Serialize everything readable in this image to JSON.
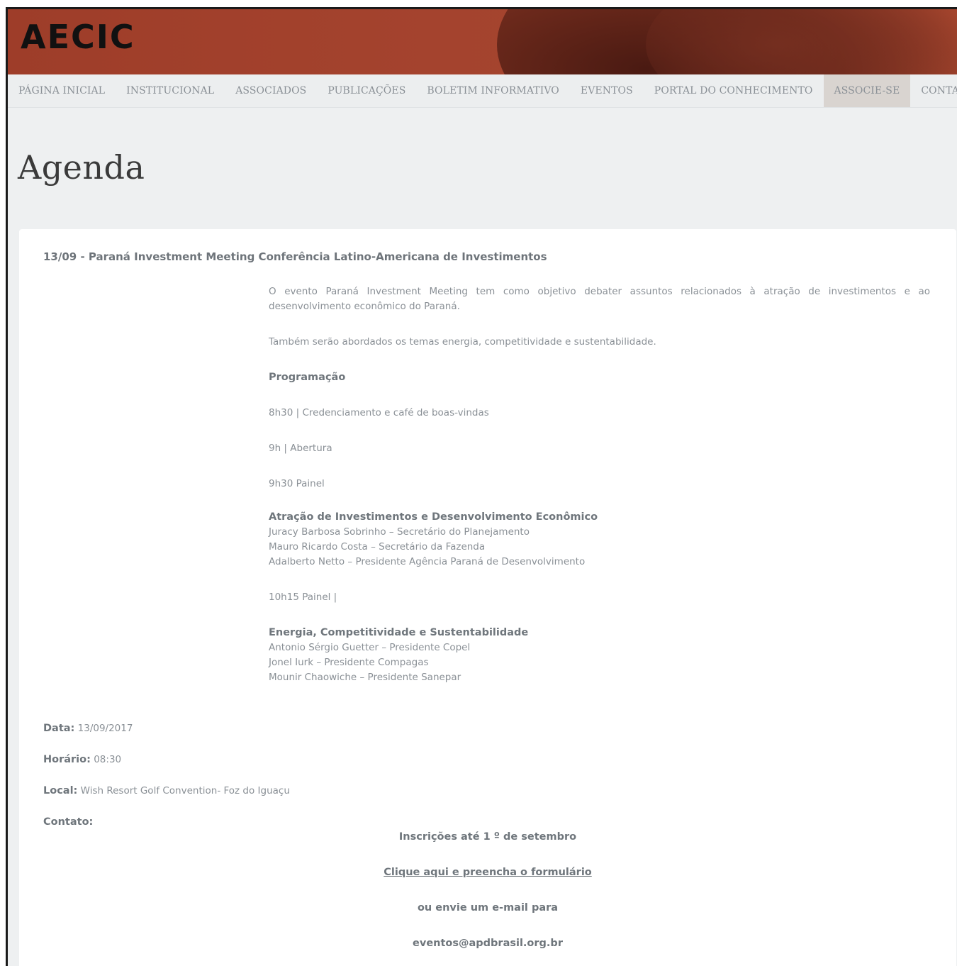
{
  "header": {
    "logo_text": "AECIC"
  },
  "nav": {
    "items": [
      {
        "label": "PÁGINA INICIAL"
      },
      {
        "label": "INSTITUCIONAL"
      },
      {
        "label": "ASSOCIADOS"
      },
      {
        "label": "PUBLICAÇÕES"
      },
      {
        "label": "BOLETIM INFORMATIVO"
      },
      {
        "label": "EVENTOS"
      },
      {
        "label": "PORTAL DO CONHECIMENTO"
      },
      {
        "label": "ASSOCIE-SE"
      },
      {
        "label": "CONTATO"
      }
    ],
    "active": "ASSOCIE-SE"
  },
  "page": {
    "title": "Agenda"
  },
  "event": {
    "title": "13/09 - Paraná Investment Meeting Conferência Latino-Americana de Investimentos",
    "intro": "O evento Paraná Investment Meeting tem como objetivo debater assuntos relacionados à atração de investimentos e ao desenvolvimento econômico do Paraná.",
    "topics": "Também serão abordados os temas energia, competitividade e sustentabilidade.",
    "program_heading": "Programação",
    "schedule": [
      "8h30 | Credenciamento e café de boas-vindas",
      "9h | Abertura",
      "9h30 Painel"
    ],
    "panel1": {
      "heading": "Atração de Investimentos e Desenvolvimento Econômico",
      "speakers": [
        "Juracy Barbosa Sobrinho – Secretário do Planejamento",
        "Mauro Ricardo Costa – Secretário da Fazenda",
        "Adalberto Netto – Presidente Agência Paraná de Desenvolvimento"
      ]
    },
    "panel2_time": "10h15 Painel |",
    "panel2": {
      "heading": "Energia, Competitividade e Sustentabilidade",
      "speakers": [
        "Antonio Sérgio Guetter – Presidente Copel",
        "Jonel Iurk – Presidente Compagas",
        "Mounir Chaowiche – Presidente Sanepar"
      ]
    },
    "meta": {
      "date_label": "Data:",
      "date_value": "13/09/2017",
      "time_label": "Horário:",
      "time_value": "08:30",
      "place_label": "Local:",
      "place_value": "Wish Resort Golf Convention- Foz do Iguaçu",
      "contact_label": "Contato:"
    },
    "cta": {
      "registration": "Inscrições até 1 º de setembro",
      "form_link": "Clique aqui e preencha o formulário",
      "or_email": "ou envie um e-mail para",
      "email": "eventos@apdbrasil.org.br"
    }
  },
  "colors": {
    "banner": "#a4432e",
    "nav_active": "#d9d4d0",
    "text_muted": "#8a9096"
  }
}
